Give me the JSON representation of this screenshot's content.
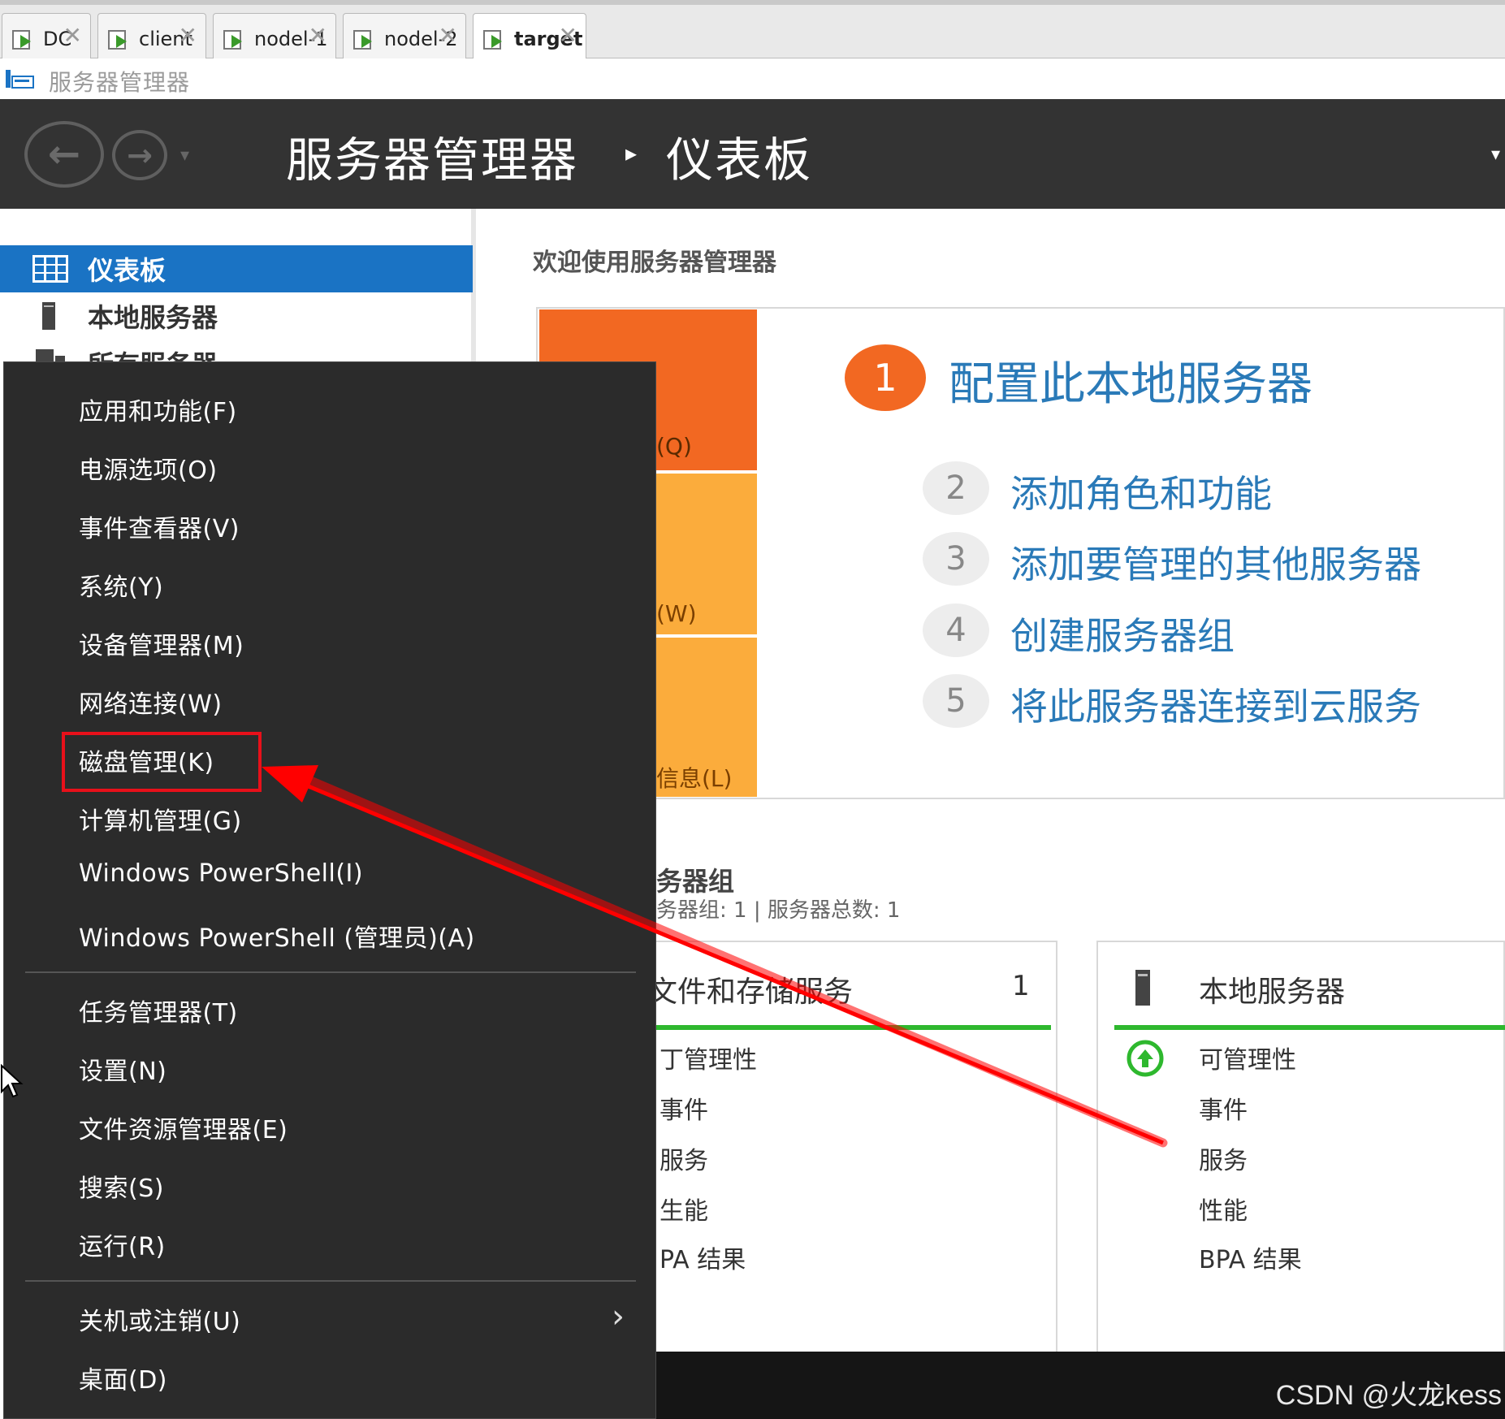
{
  "vm_tabs": [
    {
      "label": "DC",
      "active": false
    },
    {
      "label": "client",
      "active": false
    },
    {
      "label": "nodel-1",
      "active": false
    },
    {
      "label": "nodel-2",
      "active": false
    },
    {
      "label": "target",
      "active": true
    }
  ],
  "tab_close_glyph": "✕",
  "app": {
    "title": "服务器管理器"
  },
  "header": {
    "back_glyph": "←",
    "forward_glyph": "→",
    "dropdown_glyph": "▾",
    "breadcrumb_root": "服务器管理器",
    "breadcrumb_separator": "▸",
    "breadcrumb_page": "仪表板",
    "menu_glyph": "▾"
  },
  "sidebar": {
    "items": [
      {
        "label": "仪表板",
        "selected": true,
        "icon": "dashboard-grid-icon"
      },
      {
        "label": "本地服务器",
        "selected": false,
        "icon": "server-icon"
      },
      {
        "label": "所有服务器",
        "selected": false,
        "icon": "servers-icon"
      }
    ]
  },
  "main": {
    "welcome_title": "欢迎使用服务器管理器",
    "tiles": [
      {
        "label": "(Q)",
        "color": "#f26822"
      },
      {
        "label": "(W)",
        "color": "#fbac3c"
      },
      {
        "label": "信息(L)",
        "color": "#fbac3c"
      }
    ],
    "steps": [
      {
        "number": "1",
        "text": "配置此本地服务器"
      },
      {
        "number": "2",
        "text": "添加角色和功能"
      },
      {
        "number": "3",
        "text": "添加要管理的其他服务器"
      },
      {
        "number": "4",
        "text": "创建服务器组"
      },
      {
        "number": "5",
        "text": "将此服务器连接到云服务"
      }
    ],
    "group_title": "务器组",
    "group_subtitle": "务器组: 1 | 服务器总数: 1",
    "cards": [
      {
        "title": "文件和存储服务",
        "count": "1",
        "rows": [
          "可管理性",
          "事件",
          "服务",
          "性能",
          "BPA 结果"
        ],
        "rows_visible": [
          "丁管理性",
          "事件",
          "服务",
          "生能",
          "PA 结果"
        ]
      },
      {
        "title": "本地服务器",
        "count": "",
        "rows": [
          "可管理性",
          "事件",
          "服务",
          "性能",
          "BPA 结果"
        ]
      }
    ]
  },
  "context_menu": {
    "items_group1": [
      "应用和功能(F)",
      "电源选项(O)",
      "事件查看器(V)",
      "系统(Y)",
      "设备管理器(M)",
      "网络连接(W)",
      "磁盘管理(K)",
      "计算机管理(G)",
      "Windows PowerShell(I)",
      "Windows PowerShell (管理员)(A)"
    ],
    "items_group2": [
      "任务管理器(T)",
      "设置(N)",
      "文件资源管理器(E)",
      "搜索(S)",
      "运行(R)"
    ],
    "items_group3": [
      "关机或注销(U)",
      "桌面(D)"
    ],
    "submenu_glyph": "›",
    "highlighted_item": "磁盘管理(K)"
  },
  "annotation": {
    "arrow_color": "#ff0000",
    "box_color": "#e8101a"
  },
  "watermark": "CSDN @火龙kess",
  "colors": {
    "header_bg": "#333333",
    "selected_blue": "#1a73c4",
    "link_blue": "#2a7ab8",
    "orange": "#f26822",
    "amber": "#fbac3c",
    "status_green": "#2eb82e",
    "menu_bg": "#2b2b2b"
  }
}
